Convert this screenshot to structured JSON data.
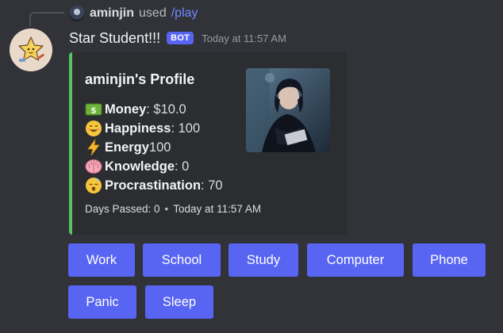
{
  "command": {
    "user": "aminjin",
    "used_text": "used",
    "command": "/play"
  },
  "author": {
    "name": "Star Student!!!",
    "bot_tag": "BOT",
    "timestamp": "Today at 11:57 AM"
  },
  "embed": {
    "title": "aminjin's Profile",
    "accent_color": "#57c55e",
    "stats": [
      {
        "icon": "money-bag-icon",
        "label": "Money",
        "value": ": $10.0"
      },
      {
        "icon": "smiley-face-icon",
        "label": "Happiness",
        "value": ": 100"
      },
      {
        "icon": "lightning-icon",
        "label": "Energy",
        "value": " 100"
      },
      {
        "icon": "brain-icon",
        "label": "Knowledge",
        "value": ": 0"
      },
      {
        "icon": "sleepy-face-icon",
        "label": "Procrastination",
        "value": ": 70"
      }
    ],
    "footer": {
      "days": "Days Passed: 0",
      "separator": "•",
      "time": "Today at 11:57 AM"
    }
  },
  "buttons": [
    {
      "label": "Work"
    },
    {
      "label": "School"
    },
    {
      "label": "Study"
    },
    {
      "label": "Computer"
    },
    {
      "label": "Phone"
    },
    {
      "label": "Panic"
    },
    {
      "label": "Sleep"
    }
  ],
  "colors": {
    "background": "#313338",
    "embed_background": "#2b2d31",
    "button": "#5865f2",
    "command_link": "#7289ff"
  }
}
